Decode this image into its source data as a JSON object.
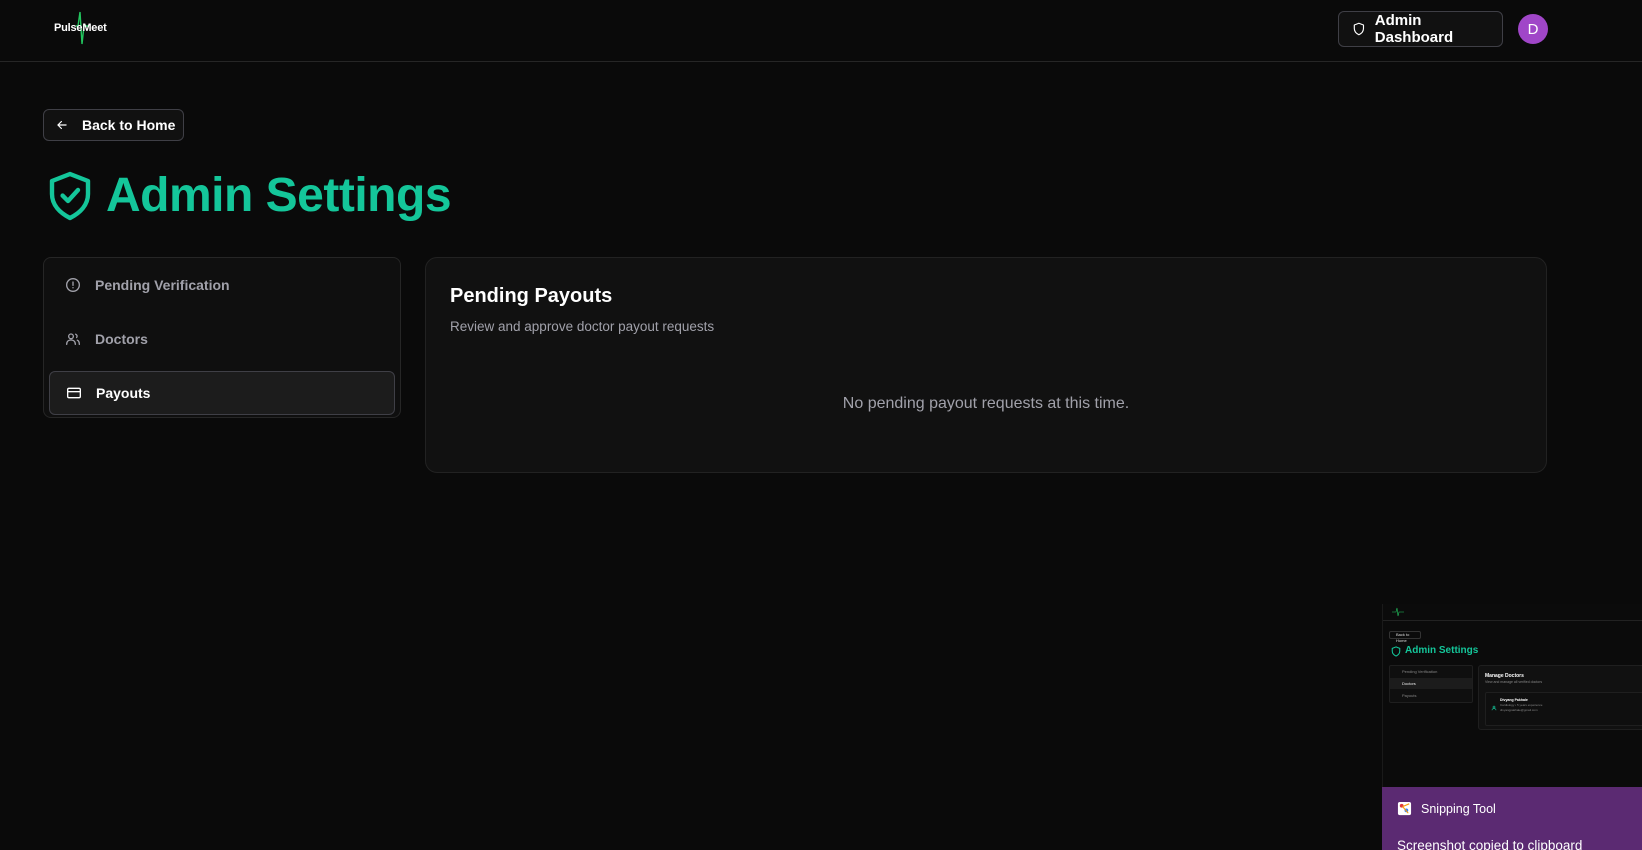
{
  "app": {
    "logo_text": "PulseMeet"
  },
  "header": {
    "admin_button_label": "Admin Dashboard",
    "avatar_initial": "D"
  },
  "back_button": {
    "label": "Back to Home"
  },
  "page": {
    "title": "Admin Settings"
  },
  "sidebar": {
    "items": [
      {
        "label": "Pending Verification",
        "icon": "alert-circle-icon",
        "active": false
      },
      {
        "label": "Doctors",
        "icon": "users-icon",
        "active": false
      },
      {
        "label": "Payouts",
        "icon": "credit-card-icon",
        "active": true
      }
    ]
  },
  "panel": {
    "title": "Pending Payouts",
    "subtitle": "Review and approve doctor payout requests",
    "empty_message": "No pending payout requests at this time."
  },
  "snipping_tool": {
    "app_name": "Snipping Tool",
    "message": "Screenshot copied to clipboard",
    "thumbnail": {
      "back_label": "Back to Home",
      "title": "Admin Settings",
      "sidebar_items": [
        "Pending Verification",
        "Doctors",
        "Payouts"
      ],
      "panel_title": "Manage Doctors",
      "panel_subtitle": "View and manage all verified doctors",
      "card_name": "Divyang Pakhale",
      "card_line1": "Cardiology • 5 years experience",
      "card_line2": "divyangpakhale@gmail.com"
    }
  },
  "colors": {
    "accent": "#14c69a",
    "background": "#0a0a0a",
    "avatar": "#a046c8",
    "toast": "#5b2a72"
  }
}
